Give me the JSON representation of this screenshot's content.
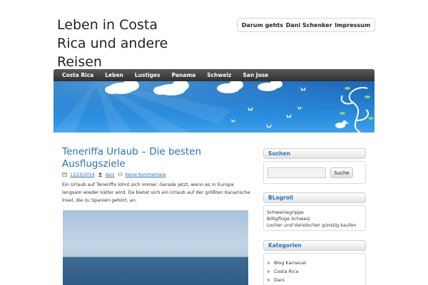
{
  "site": {
    "title": "Leben in Costa Rica und andere Reisen"
  },
  "top_menu": {
    "items": [
      {
        "label": "Darum gehts"
      },
      {
        "label": "Dani Schenker"
      },
      {
        "label": "Impressum"
      }
    ]
  },
  "main_nav": {
    "items": [
      {
        "label": "Costa Rica"
      },
      {
        "label": "Leben"
      },
      {
        "label": "Lustiges"
      },
      {
        "label": "Panama"
      },
      {
        "label": "Schweiz"
      },
      {
        "label": "San Jose"
      }
    ]
  },
  "post": {
    "title": "Teneriffa Urlaub – Die besten Ausflugsziele",
    "date": "13/10/2014",
    "author": "dani",
    "comments": "Keine Kommentare",
    "body": "Ein Urlaub auf Teneriffa lohnt sich immer. Gerade jetzt, wenn es in Europa langsam wieder kälter wird. Da bietet sich ein Urlaub auf der größten Kanarische Insel, die zu Spanien gehört, an."
  },
  "sidebar": {
    "search": {
      "heading": "Suchen",
      "input_value": "",
      "button_label": "Suche"
    },
    "blogroll": {
      "heading": "BLogroll",
      "links": [
        {
          "label": "Schweinegrippe"
        },
        {
          "label": "Billigflüge Schweiz"
        },
        {
          "label": "Locher und Variolocher günstig kaufen"
        }
      ]
    },
    "categories": {
      "heading": "Kategorien",
      "items": [
        {
          "label": "Blog Karneval"
        },
        {
          "label": "Costa Rica"
        },
        {
          "label": "Dani"
        }
      ]
    }
  },
  "colors": {
    "link_blue": "#2673b8",
    "nav_dark": "#3a3a3a",
    "header_blue": "#2a8ee0"
  }
}
